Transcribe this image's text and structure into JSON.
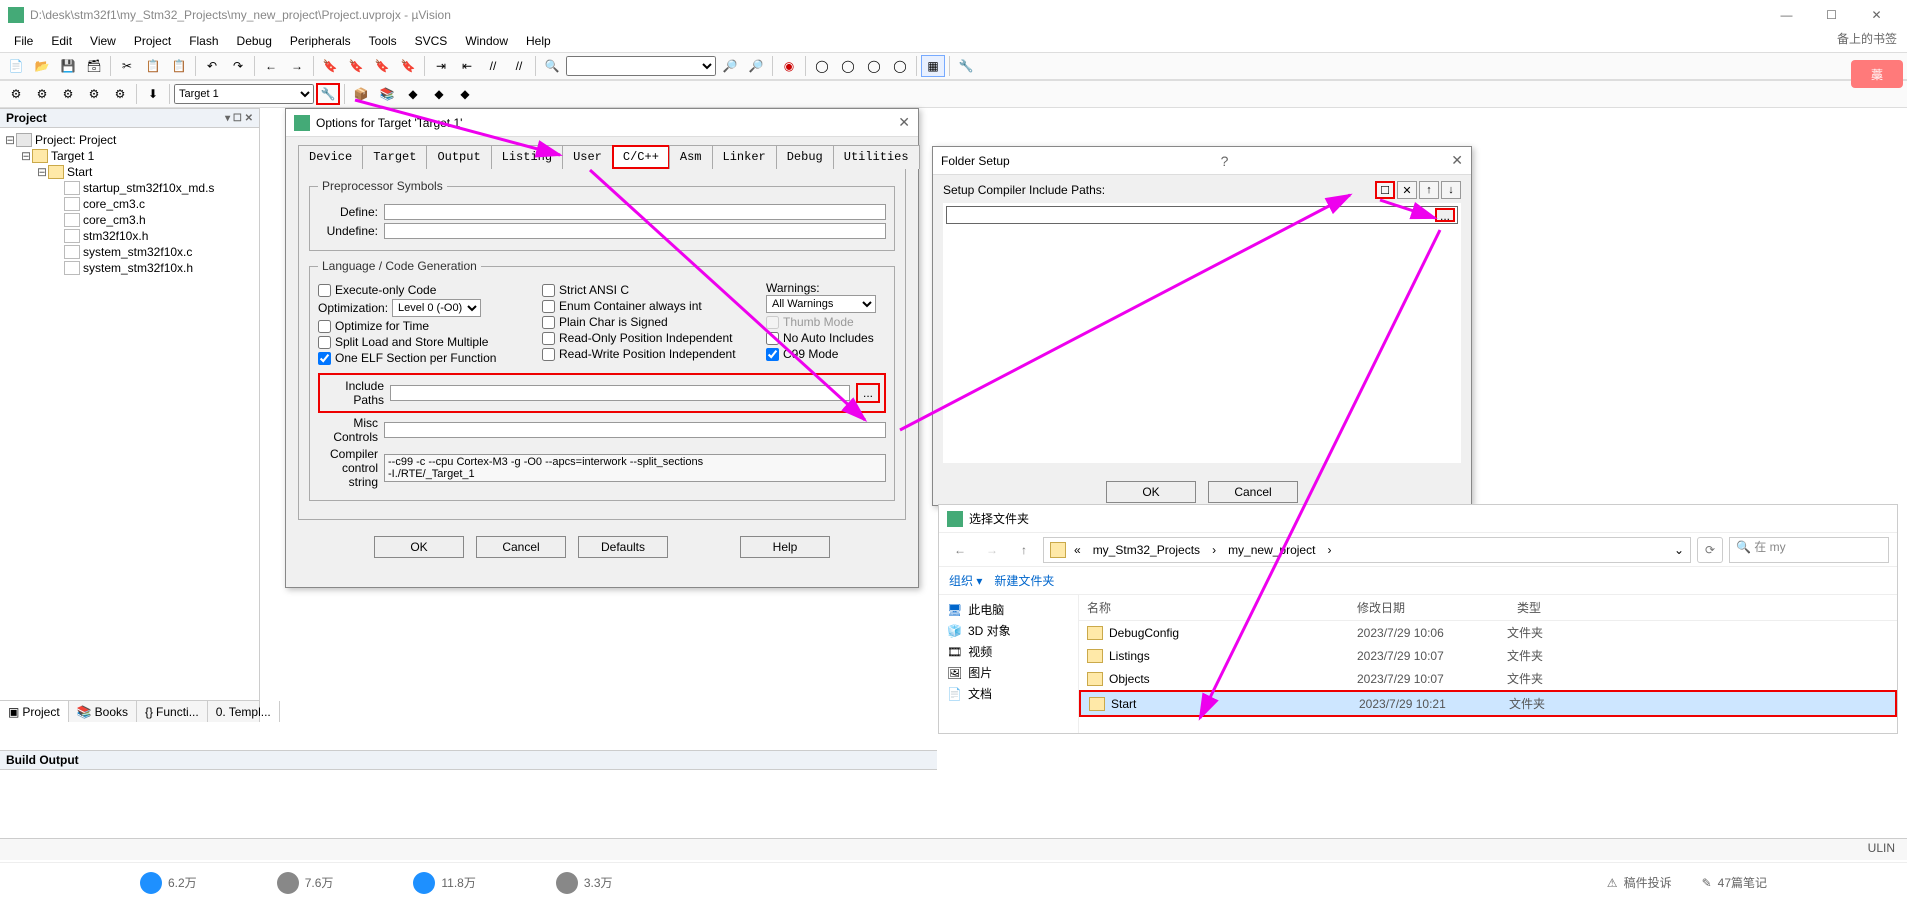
{
  "window": {
    "title": "D:\\desk\\stm32f1\\my_Stm32_Projects\\my_new_project\\Project.uvprojx - µVision",
    "min": "—",
    "max": "☐",
    "close": "✕"
  },
  "menu": [
    "File",
    "Edit",
    "View",
    "Project",
    "Flash",
    "Debug",
    "Peripherals",
    "Tools",
    "SVCS",
    "Window",
    "Help"
  ],
  "target_selector": "Target 1",
  "project_panel": {
    "title": "Project",
    "tree": {
      "root": "Project: Project",
      "target": "Target 1",
      "group": "Start",
      "files": [
        "startup_stm32f10x_md.s",
        "core_cm3.c",
        "core_cm3.h",
        "stm32f10x.h",
        "system_stm32f10x.c",
        "system_stm32f10x.h"
      ]
    },
    "tabs": [
      "Project",
      "Books",
      "Functi...",
      "Templ..."
    ]
  },
  "build_output_title": "Build Output",
  "status_text": "ULIN",
  "options_dialog": {
    "title": "Options for Target 'Target 1'",
    "tabs": [
      "Device",
      "Target",
      "Output",
      "Listing",
      "User",
      "C/C++",
      "Asm",
      "Linker",
      "Debug",
      "Utilities"
    ],
    "active_tab": "C/C++",
    "preproc_legend": "Preprocessor Symbols",
    "define_label": "Define:",
    "undefine_label": "Undefine:",
    "lang_legend": "Language / Code Generation",
    "chk_exec_only": "Execute-only Code",
    "opt_label": "Optimization:",
    "opt_value": "Level 0 (-O0)",
    "chk_opt_time": "Optimize for Time",
    "chk_split_load": "Split Load and Store Multiple",
    "chk_one_elf": "One ELF Section per Function",
    "chk_strict_ansi": "Strict ANSI C",
    "chk_enum_int": "Enum Container always int",
    "chk_plain_char": "Plain Char is Signed",
    "chk_ro_pi": "Read-Only Position Independent",
    "chk_rw_pi": "Read-Write Position Independent",
    "warn_label": "Warnings:",
    "warn_value": "All Warnings",
    "chk_thumb": "Thumb Mode",
    "chk_noauto": "No Auto Includes",
    "chk_c99": "C99 Mode",
    "include_label": "Include\nPaths",
    "misc_label": "Misc\nControls",
    "compiler_label": "Compiler\ncontrol\nstring",
    "compiler_value": "--c99 -c --cpu Cortex-M3 -g -O0 --apcs=interwork --split_sections\n-I./RTE/_Target_1",
    "btn_ok": "OK",
    "btn_cancel": "Cancel",
    "btn_defaults": "Defaults",
    "btn_help": "Help"
  },
  "folder_setup": {
    "title": "Folder Setup",
    "help": "?",
    "close": "✕",
    "label": "Setup Compiler Include Paths:",
    "tool_new": "☐",
    "tool_del": "✕",
    "tool_up": "↑",
    "tool_down": "↓",
    "dots": "...",
    "btn_ok": "OK",
    "btn_cancel": "Cancel"
  },
  "explorer": {
    "title": "选择文件夹",
    "back": "←",
    "fwd": "→",
    "up": "↑",
    "crumb_prefix": "«",
    "crumb1": "my_Stm32_Projects",
    "crumb2": "my_new_project",
    "crumb_sep": "›",
    "dropdown": "⌄",
    "refresh": "⟳",
    "search_placeholder": "在 my",
    "search_icon": "🔍",
    "op_org": "组织 ▾",
    "op_new": "新建文件夹",
    "side_items": [
      "此电脑",
      "3D 对象",
      "视频",
      "图片",
      "文档"
    ],
    "col_name": "名称",
    "col_date": "修改日期",
    "col_type": "类型",
    "rows": [
      {
        "name": "DebugConfig",
        "date": "2023/7/29 10:06",
        "type": "文件夹"
      },
      {
        "name": "Listings",
        "date": "2023/7/29 10:07",
        "type": "文件夹"
      },
      {
        "name": "Objects",
        "date": "2023/7/29 10:07",
        "type": "文件夹"
      },
      {
        "name": "Start",
        "date": "2023/7/29 10:21",
        "type": "文件夹"
      }
    ]
  },
  "social": {
    "like": "6.2万",
    "coin": "7.6万",
    "star": "11.8万",
    "share": "3.3万",
    "report": "稿件投诉",
    "notes": "47篇笔记"
  },
  "bookmark_label": "备上的书签",
  "pink_btn": "藁"
}
